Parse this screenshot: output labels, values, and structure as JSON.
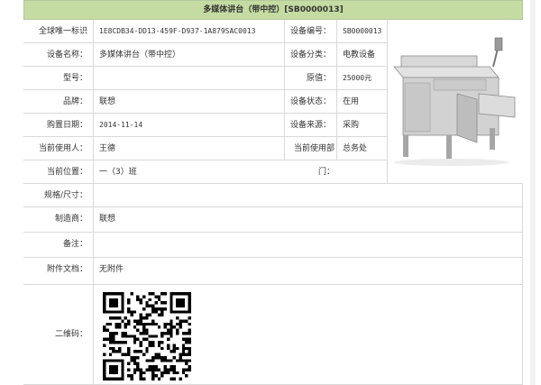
{
  "header": {
    "title": "多媒体讲台（带中控）[SB0000013]"
  },
  "fields": {
    "uid_label": "全球唯一标识符：",
    "uid_value": "1E8CDB34-DD13-459F-D937-1A879SAC0013",
    "code_label": "设备编号：",
    "code_value": "SB0000013",
    "name_label": "设备名称：",
    "name_value": "多媒体讲台（带中控）",
    "category_label": "设备分类：",
    "category_value": "电教设备",
    "model_label": "型号：",
    "model_value": "",
    "price_label": "原值：",
    "price_value": "25000元",
    "brand_label": "品牌：",
    "brand_value": "联想",
    "status_label": "设备状态：",
    "status_value": "在用",
    "date_label": "购置日期：",
    "date_value": "2014-11-14",
    "source_label": "设备来源：",
    "source_value": "采购",
    "user_label": "当前使用人：",
    "user_value": "王德",
    "dept_label": "当前使用部门：",
    "dept_value": "总务处",
    "location_label": "当前位置：",
    "location_value": "一（3）班",
    "spec_label": "规格/尺寸：",
    "spec_value": "",
    "maker_label": "制造商：",
    "maker_value": "联想",
    "note_label": "备注：",
    "note_value": "",
    "attach_label": "附件文档：",
    "attach_value": "无附件",
    "qr_label": "二维码："
  }
}
